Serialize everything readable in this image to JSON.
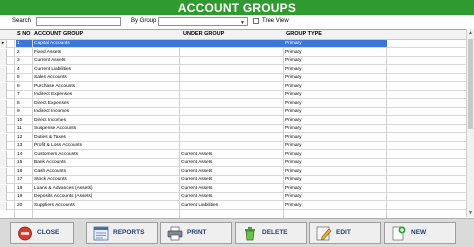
{
  "header": {
    "title": "ACCOUNT GROUPS",
    "bg_color": "#2f9a2f"
  },
  "toolbar": {
    "search_label": "Search",
    "search_value": "",
    "by_group_label": "By Group",
    "group_value": "",
    "tree_view_label": "Tree View",
    "tree_view_checked": false
  },
  "grid": {
    "columns": [
      "S NO",
      "ACCOUNT GROUP",
      "UNDER GROUP",
      "GROUP TYPE"
    ],
    "selected_row_indicator": "▸",
    "selected_index": 0,
    "rows": [
      {
        "sno": "1",
        "account_group": "Capital Accounts",
        "under_group": "",
        "group_type": "Primary"
      },
      {
        "sno": "2",
        "account_group": "Fixed Assets",
        "under_group": "",
        "group_type": "Primary"
      },
      {
        "sno": "3",
        "account_group": "Current Assets",
        "under_group": "",
        "group_type": "Primary"
      },
      {
        "sno": "4",
        "account_group": "Current Liabilities",
        "under_group": "",
        "group_type": "Primary"
      },
      {
        "sno": "5",
        "account_group": "Sales Accounts",
        "under_group": "",
        "group_type": "Primary"
      },
      {
        "sno": "6",
        "account_group": "Purchase Accounts",
        "under_group": "",
        "group_type": "Primary"
      },
      {
        "sno": "7",
        "account_group": "Indirect Expenses",
        "under_group": "",
        "group_type": "Primary"
      },
      {
        "sno": "8",
        "account_group": "Direct Expenses",
        "under_group": "",
        "group_type": "Primary"
      },
      {
        "sno": "9",
        "account_group": "Indirect Incomes",
        "under_group": "",
        "group_type": "Primary"
      },
      {
        "sno": "10",
        "account_group": "Direct Incomes",
        "under_group": "",
        "group_type": "Primary"
      },
      {
        "sno": "11",
        "account_group": "Suspense Accounts",
        "under_group": "",
        "group_type": "Primary"
      },
      {
        "sno": "12",
        "account_group": "Duties & Taxes",
        "under_group": "",
        "group_type": "Primary"
      },
      {
        "sno": "13",
        "account_group": "Profit & Loss Accounts",
        "under_group": "",
        "group_type": "Primary"
      },
      {
        "sno": "14",
        "account_group": "Customers Accounts",
        "under_group": "Current Assets",
        "group_type": "Primary"
      },
      {
        "sno": "15",
        "account_group": "Bank Accounts",
        "under_group": "Current Assets",
        "group_type": "Primary"
      },
      {
        "sno": "16",
        "account_group": "Cash Accounts",
        "under_group": "Current Assets",
        "group_type": "Primary"
      },
      {
        "sno": "17",
        "account_group": "Stock Accounts",
        "under_group": "Current Assets",
        "group_type": "Primary"
      },
      {
        "sno": "18",
        "account_group": "Loans & Advances (Assets)",
        "under_group": "Current Assets",
        "group_type": "Primary"
      },
      {
        "sno": "19",
        "account_group": "Deposits Accounts (Assets)",
        "under_group": "Current Assets",
        "group_type": "Primary"
      },
      {
        "sno": "20",
        "account_group": "Suppliers Accounts",
        "under_group": "Current Liabilities",
        "group_type": "Primary"
      }
    ]
  },
  "footer": {
    "buttons": [
      {
        "label": "CLOSE",
        "icon": "close-icon"
      },
      {
        "label": "REPORTS",
        "icon": "reports-icon"
      },
      {
        "label": "PRINT",
        "icon": "print-icon"
      },
      {
        "label": "DELETE",
        "icon": "delete-icon"
      },
      {
        "label": "EDIT",
        "icon": "edit-icon"
      },
      {
        "label": "NEW",
        "icon": "new-icon"
      }
    ]
  }
}
